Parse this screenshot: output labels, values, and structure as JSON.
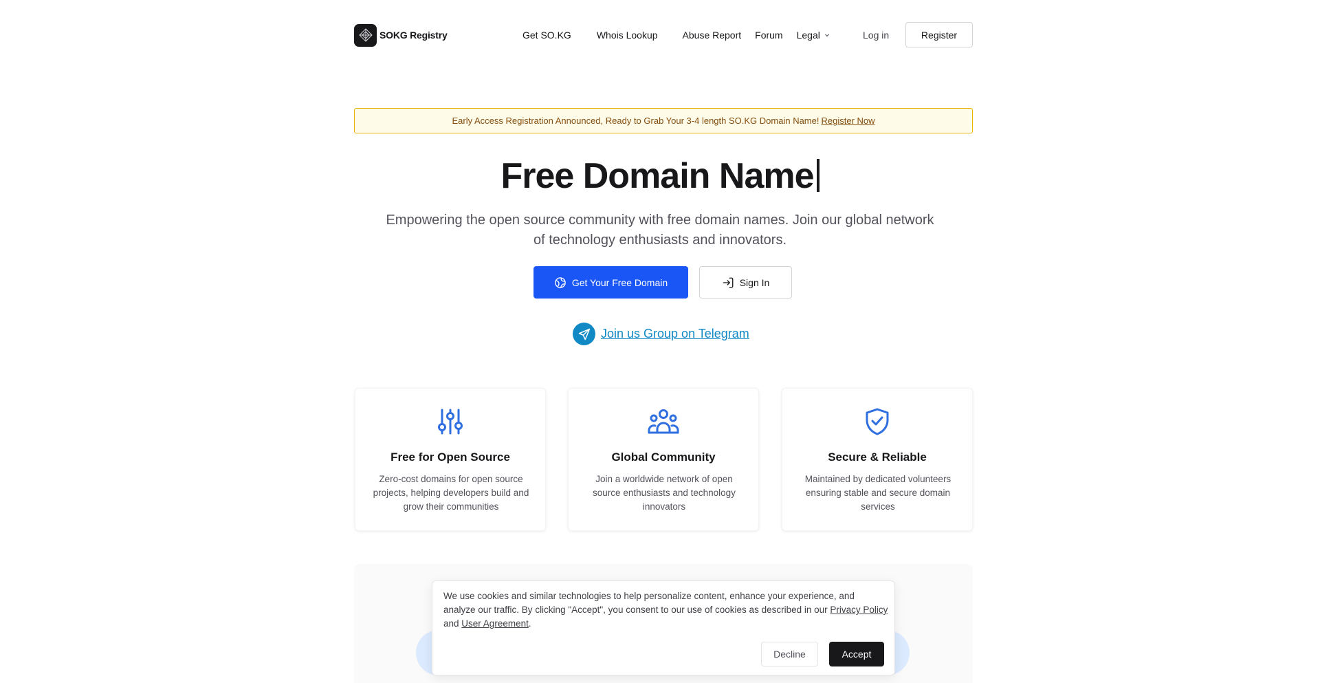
{
  "header": {
    "brand": "SOKG Registry",
    "nav": [
      {
        "label": "Get SO.KG"
      },
      {
        "label": "Whois Lookup"
      },
      {
        "label": "Abuse Report"
      },
      {
        "label": "Forum"
      },
      {
        "label": "Legal"
      }
    ],
    "login_label": "Log in",
    "register_label": "Register"
  },
  "banner": {
    "text": "Early Access Registration Announced, Ready to Grab Your 3-4 length SO.KG Domain Name!",
    "link": "Register Now"
  },
  "hero": {
    "title": "Free Domain Name",
    "subtitle": "Empowering the open source community with free domain names. Join our global network of technology enthusiasts and innovators.",
    "primary_button": "Get Your Free Domain",
    "secondary_button": "Sign In",
    "telegram_link": "Join us Group on Telegram"
  },
  "features": [
    {
      "title": "Free for Open Source",
      "description": "Zero-cost domains for open source projects, helping developers build and grow their communities",
      "icon": "sliders-icon"
    },
    {
      "title": "Global Community",
      "description": "Join a worldwide network of open source enthusiasts and technology innovators",
      "icon": "users-group-icon"
    },
    {
      "title": "Secure & Reliable",
      "description": "Maintained by dedicated volunteers ensuring stable and secure domain services",
      "icon": "shield-check-icon"
    }
  ],
  "cookie": {
    "text_before": "We use cookies and similar technologies to help personalize content, enhance your experience, and analyze our traffic. By clicking \"Accept\", you consent to our use of cookies as described in our",
    "privacy_link": "Privacy Policy",
    "and_text": "and",
    "agreement_link": "User Agreement",
    "end": ".",
    "decline_label": "Decline",
    "accept_label": "Accept"
  },
  "colors": {
    "primary": "#1a56f5",
    "telegram": "#1089c5",
    "feature_icon": "#2f6fe0",
    "banner_bg": "#fefce8",
    "banner_border": "#eab308",
    "dark": "#18181b"
  }
}
